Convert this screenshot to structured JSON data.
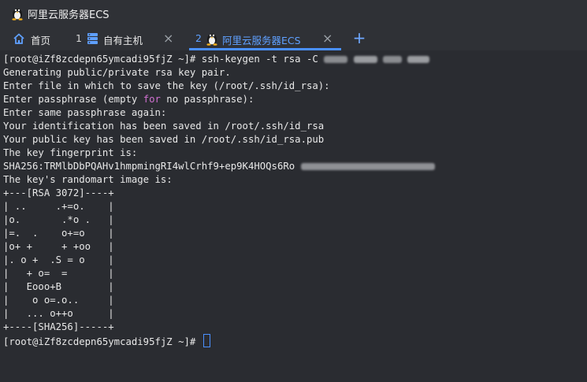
{
  "window": {
    "title": "阿里云服务器ECS",
    "icon": "tux-icon"
  },
  "tabs": [
    {
      "number": "",
      "label": "首页",
      "icon": "home-icon",
      "active": false,
      "closable": false
    },
    {
      "number": "1",
      "label": "自有主机",
      "icon": "server-icon",
      "active": false,
      "closable": true
    },
    {
      "number": "2",
      "label": "阿里云服务器ECS",
      "icon": "tux-icon",
      "active": true,
      "closable": true
    }
  ],
  "add_tab_label": "+",
  "close_glyph": "×",
  "colors": {
    "accent": "#4a90ff",
    "background": "#2a2c31",
    "text": "#e8e8e8",
    "keyword": "#d070d0"
  },
  "terminal": {
    "prompt": "[root@iZf8zcdepn65ymcadi95fjZ ~]#",
    "command": " ssh-keygen -t rsa -C ",
    "lines": [
      "Generating public/private rsa key pair.",
      "Enter file in which to save the key (/root/.ssh/id_rsa):",
      "Enter same passphrase again:",
      "Your identification has been saved in /root/.ssh/id_rsa",
      "Your public key has been saved in /root/.ssh/id_rsa.pub",
      "The key fingerprint is:",
      "SHA256:TRMlbDbPQAHv1hmpmingRI4wlCrhf9+ep9K4HOQs6Ro ",
      "The key's randomart image is:"
    ],
    "passphrase_line": {
      "before": "Enter passphrase (empty ",
      "keyword": "for",
      "after": " no passphrase):"
    },
    "randomart": [
      "+---[RSA 3072]----+",
      "| ..     .+=o.    |",
      "|o.       .*o .   |",
      "|=.  .    o+=o    |",
      "|o+ +     + +oo   |",
      "|. o +  .S = o    |",
      "|   + o=  =       |",
      "|   Eooo+B        |",
      "|    o o=.o..     |",
      "|   ... o++o      |",
      "+----[SHA256]-----+"
    ],
    "final_prompt": "[root@iZf8zcdepn65ymcadi95fjZ ~]#"
  }
}
